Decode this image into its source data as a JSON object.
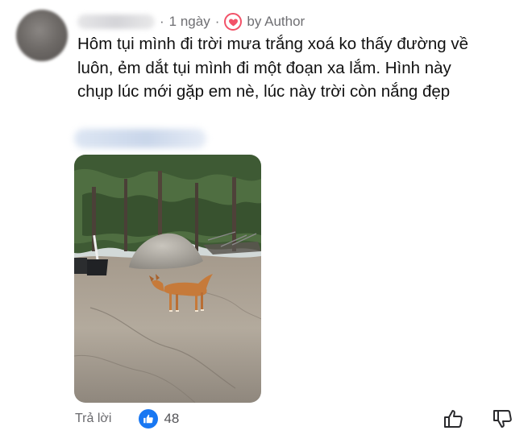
{
  "comment": {
    "timestamp": "1 ngày",
    "separator": "·",
    "author_badge": "by Author",
    "body_lines": [
      "Hôm tụi mình đi trời mưa trắng xoá ko thấy đường về",
      "luôn, ẻm dắt tụi mình đi một đoạn xa lắm. Hình này",
      "chụp lúc mới gặp em nè, lúc này trời còn nắng đẹp"
    ]
  },
  "actions": {
    "reply_label": "Trả lời",
    "like_count": "48"
  },
  "colors": {
    "like_blue": "#1877f2",
    "heart_red": "#f25268"
  },
  "icons": {
    "heart": "heart-icon",
    "like": "thumbs-up-icon",
    "upvote": "thumbs-up-outline-icon",
    "downvote": "thumbs-down-outline-icon"
  }
}
